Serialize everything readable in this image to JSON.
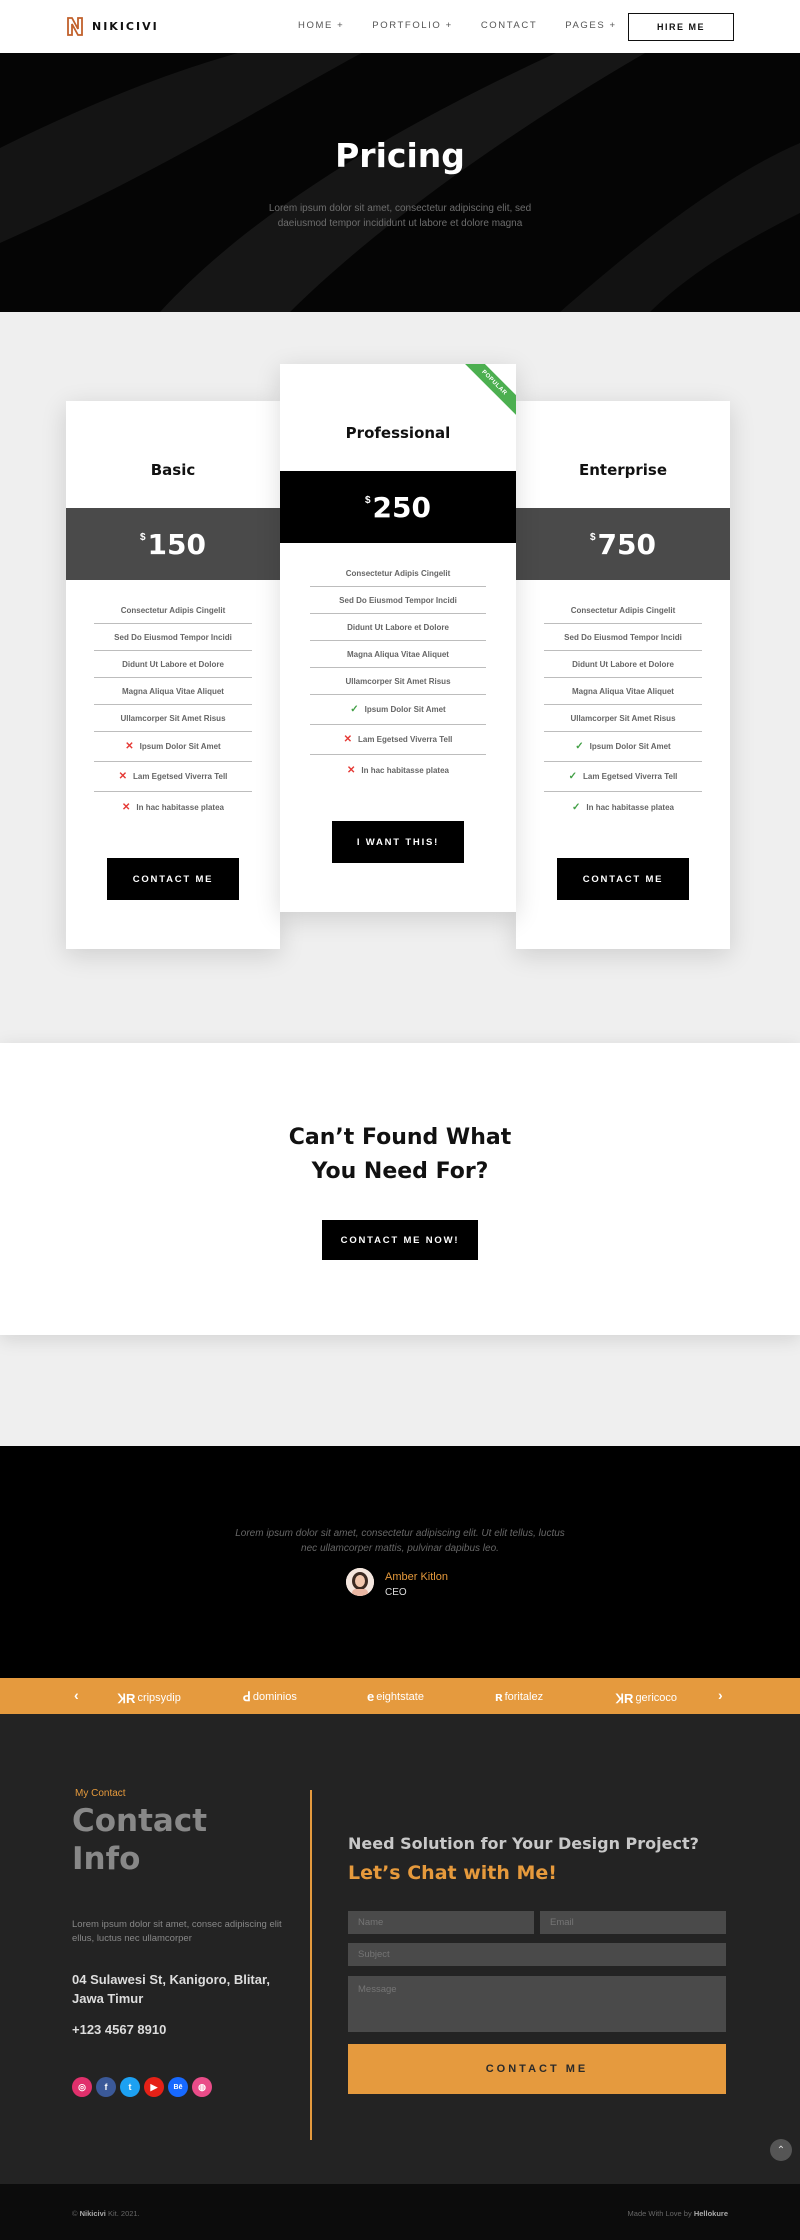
{
  "nav": {
    "brand": "NIKICIVI",
    "items": [
      "HOME +",
      "PORTFOLIO +",
      "CONTACT",
      "PAGES +"
    ],
    "hire_label": "HIRE ME"
  },
  "hero": {
    "title": "Pricing",
    "subtitle": "Lorem ipsum dolor sit amet, consectetur adipiscing elit, sed daeiusmod tempor incididunt ut labore et dolore magna"
  },
  "pricing": {
    "currency": "$",
    "basic": {
      "title": "Basic",
      "price": "150",
      "features": [
        {
          "text": "Consectetur Adipis Cingelit",
          "icon": "none"
        },
        {
          "text": "Sed Do Eiusmod Tempor Incidi",
          "icon": "none"
        },
        {
          "text": "Didunt Ut Labore et Dolore",
          "icon": "none"
        },
        {
          "text": "Magna Aliqua Vitae Aliquet",
          "icon": "none"
        },
        {
          "text": "Ullamcorper Sit Amet Risus",
          "icon": "none"
        },
        {
          "text": "Ipsum Dolor Sit Amet",
          "icon": "cross"
        },
        {
          "text": "Lam Egetsed Viverra Tell",
          "icon": "cross"
        },
        {
          "text": "In hac habitasse platea",
          "icon": "cross"
        }
      ],
      "cta": "CONTACT ME"
    },
    "professional": {
      "title": "Professional",
      "price": "250",
      "ribbon": "POPULAR",
      "features": [
        {
          "text": "Consectetur Adipis Cingelit",
          "icon": "none"
        },
        {
          "text": "Sed Do Eiusmod Tempor Incidi",
          "icon": "none"
        },
        {
          "text": "Didunt Ut Labore et Dolore",
          "icon": "none"
        },
        {
          "text": "Magna Aliqua Vitae Aliquet",
          "icon": "none"
        },
        {
          "text": "Ullamcorper Sit Amet Risus",
          "icon": "none"
        },
        {
          "text": "Ipsum Dolor Sit Amet",
          "icon": "check"
        },
        {
          "text": "Lam Egetsed Viverra Tell",
          "icon": "cross"
        },
        {
          "text": "In hac habitasse platea",
          "icon": "cross"
        }
      ],
      "cta": "I WANT THIS!"
    },
    "enterprise": {
      "title": "Enterprise",
      "price": "750",
      "features": [
        {
          "text": "Consectetur Adipis Cingelit",
          "icon": "none"
        },
        {
          "text": "Sed Do Eiusmod Tempor Incidi",
          "icon": "none"
        },
        {
          "text": "Didunt Ut Labore et Dolore",
          "icon": "none"
        },
        {
          "text": "Magna Aliqua Vitae Aliquet",
          "icon": "none"
        },
        {
          "text": "Ullamcorper Sit Amet Risus",
          "icon": "none"
        },
        {
          "text": "Ipsum Dolor Sit Amet",
          "icon": "check"
        },
        {
          "text": "Lam Egetsed Viverra Tell",
          "icon": "check"
        },
        {
          "text": "In hac habitasse platea",
          "icon": "check"
        }
      ],
      "cta": "CONTACT ME"
    }
  },
  "cta_section": {
    "title_line1": "Can’t Found What",
    "title_line2": "You Need For?",
    "button": "CONTACT ME NOW!"
  },
  "testimonial": {
    "quote": "Lorem ipsum dolor sit amet, consectetur adipiscing elit. Ut elit tellus, luctus nec ullamcorper mattis, pulvinar dapibus leo.",
    "name": "Amber Kitlon",
    "role": "CEO"
  },
  "brands": {
    "prev": "‹",
    "next": "›",
    "items": [
      {
        "icon": "ꞰR",
        "name": "cripsydip"
      },
      {
        "icon": "ꓒ",
        "name": "dominios"
      },
      {
        "icon": "e",
        "name": "eightstate"
      },
      {
        "icon": "ʀ",
        "name": "foritalez"
      },
      {
        "icon": "ꞰR",
        "name": "gericoco"
      }
    ]
  },
  "contact": {
    "eyebrow": "My Contact",
    "title_line1": "Contact",
    "title_line2": "Info",
    "description": "Lorem ipsum dolor sit amet, consec adipiscing elit ellus, luctus nec ullamcorper",
    "address": "04 Sulawesi St, Kanigoro, Blitar, Jawa Timur",
    "phone": "+123 4567 8910",
    "question": "Need Solution for Your Design Project?",
    "chat": "Let’s Chat with Me!",
    "name_placeholder": "Name",
    "email_placeholder": "Email",
    "subject_placeholder": "Subject",
    "message_placeholder": "Message",
    "submit": "CONTACT ME",
    "socials": [
      {
        "icon": "instagram-icon",
        "glyph": "◎",
        "color": "#e1306c"
      },
      {
        "icon": "facebook-icon",
        "glyph": "f",
        "color": "#3b5998"
      },
      {
        "icon": "twitter-icon",
        "glyph": "t",
        "color": "#1da1f2"
      },
      {
        "icon": "youtube-icon",
        "glyph": "▶",
        "color": "#e62117"
      },
      {
        "icon": "behance-icon",
        "glyph": "Bē",
        "color": "#1769ff"
      },
      {
        "icon": "dribbble-icon",
        "glyph": "◍",
        "color": "#ea4c89"
      }
    ]
  },
  "footer": {
    "copyright_prefix": "© ",
    "brand": "Nikicivi",
    "copyright_suffix": " Kit. 2021.",
    "made_with": "Made With Love by ",
    "author": "Hellokure"
  },
  "colors": {
    "accent": "#e59a3e",
    "dark": "#000000",
    "check": "#43a047",
    "cross": "#e53935"
  }
}
